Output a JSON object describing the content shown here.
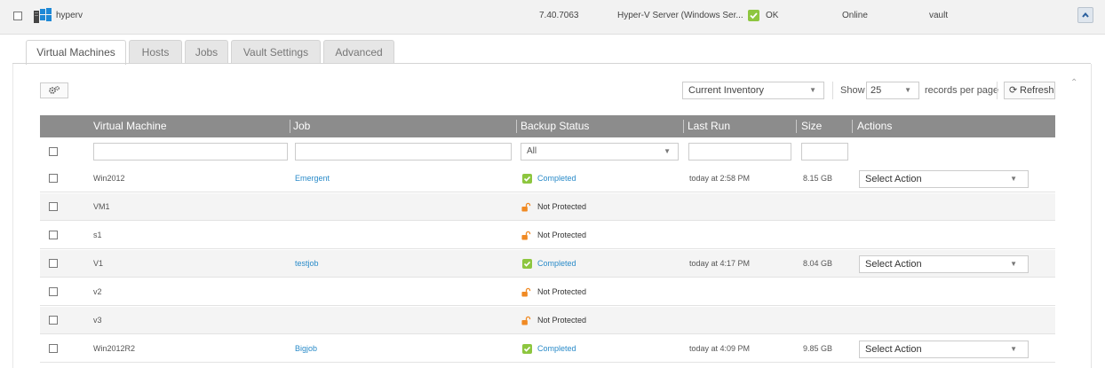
{
  "host": {
    "name": "hyperv",
    "version": "7.40.7063",
    "type": "Hyper-V Server (Windows Ser...",
    "status": "OK",
    "state": "Online",
    "vault": "vault"
  },
  "tabs": [
    {
      "label": "Virtual Machines",
      "active": true
    },
    {
      "label": "Hosts",
      "active": false
    },
    {
      "label": "Jobs",
      "active": false
    },
    {
      "label": "Vault Settings",
      "active": false
    },
    {
      "label": "Advanced",
      "active": false
    }
  ],
  "toolbar": {
    "inventory_value": "Current Inventory",
    "show_label": "Show",
    "page_size": "25",
    "records_label": "records per page",
    "refresh_label": "Refresh"
  },
  "table": {
    "headers": [
      "Virtual Machine",
      "Job",
      "Backup Status",
      "Last Run",
      "Size",
      "Actions"
    ],
    "status_filter": "All",
    "rows": [
      {
        "vm": "Win2012",
        "job": "Emergent",
        "status": "Completed",
        "last_run": "today at 2:58 PM",
        "size": "8.15 GB",
        "action": "Select Action"
      },
      {
        "vm": "VM1",
        "job": "",
        "status": "Not Protected",
        "last_run": "",
        "size": "",
        "action": ""
      },
      {
        "vm": "s1",
        "job": "",
        "status": "Not Protected",
        "last_run": "",
        "size": "",
        "action": ""
      },
      {
        "vm": "V1",
        "job": "testjob",
        "status": "Completed",
        "last_run": "today at 4:17 PM",
        "size": "8.04 GB",
        "action": "Select Action"
      },
      {
        "vm": "v2",
        "job": "",
        "status": "Not Protected",
        "last_run": "",
        "size": "",
        "action": ""
      },
      {
        "vm": "v3",
        "job": "",
        "status": "Not Protected",
        "last_run": "",
        "size": "",
        "action": ""
      },
      {
        "vm": "Win2012R2",
        "job": "Bigjob",
        "status": "Completed",
        "last_run": "today at 4:09 PM",
        "size": "9.85 GB",
        "action": "Select Action"
      }
    ]
  },
  "colors": {
    "header_bg": "#8c8c8c",
    "link": "#2a8bc9",
    "ok_green": "#8dc63f",
    "lock_orange": "#f08a24"
  },
  "icons": {
    "host": "windows-server-icon",
    "status_ok": "check-icon",
    "status_unprotected": "unlock-icon",
    "toolbar": "gears-icon",
    "refresh": "refresh-icon",
    "collapse": "chevron-up-icon"
  }
}
